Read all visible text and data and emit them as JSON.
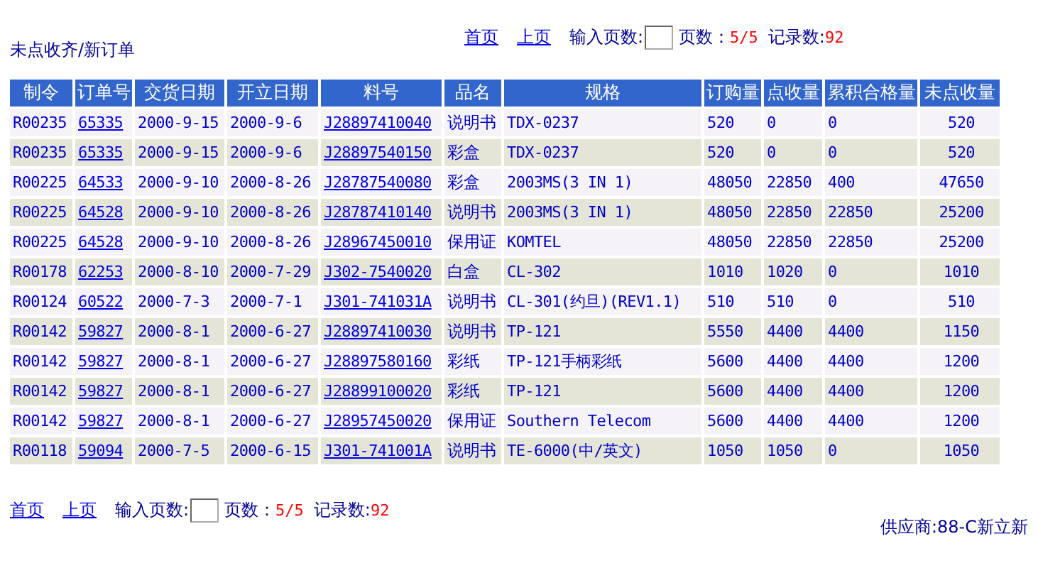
{
  "title": "未点收齐/新订单",
  "pager_top": {
    "links": [
      "首页",
      "上页"
    ],
    "input_label": "输入页数:",
    "page_label": "页数：",
    "page_value": "5/5",
    "record_label": "记录数:",
    "record_value": "92"
  },
  "table": {
    "columns": [
      {
        "label": "制令",
        "kind": "text"
      },
      {
        "label": "订单号",
        "kind": "link"
      },
      {
        "label": "交货日期",
        "kind": "text"
      },
      {
        "label": "开立日期",
        "kind": "text"
      },
      {
        "label": "料号",
        "kind": "link"
      },
      {
        "label": "品名",
        "kind": "text"
      },
      {
        "label": "规格",
        "kind": "text"
      },
      {
        "label": "订购量",
        "kind": "text"
      },
      {
        "label": "点收量",
        "kind": "text"
      },
      {
        "label": "累积合格量",
        "kind": "text"
      },
      {
        "label": "未点收量",
        "kind": "centered"
      }
    ],
    "rows": [
      [
        "R00235",
        "65335",
        "2000-9-15",
        "2000-9-6",
        "J28897410040",
        "说明书",
        "TDX-0237",
        "520",
        "0",
        "0",
        "520"
      ],
      [
        "R00235",
        "65335",
        "2000-9-15",
        "2000-9-6",
        "J28897540150",
        "彩盒",
        "TDX-0237",
        "520",
        "0",
        "0",
        "520"
      ],
      [
        "R00225",
        "64533",
        "2000-9-10",
        "2000-8-26",
        "J28787540080",
        "彩盒",
        "2003MS(3 IN 1)",
        "48050",
        "22850",
        "400",
        "47650"
      ],
      [
        "R00225",
        "64528",
        "2000-9-10",
        "2000-8-26",
        "J28787410140",
        "说明书",
        "2003MS(3 IN 1)",
        "48050",
        "22850",
        "22850",
        "25200"
      ],
      [
        "R00225",
        "64528",
        "2000-9-10",
        "2000-8-26",
        "J28967450010",
        "保用证",
        "KOMTEL",
        "48050",
        "22850",
        "22850",
        "25200"
      ],
      [
        "R00178",
        "62253",
        "2000-8-10",
        "2000-7-29",
        "J302-7540020",
        "白盒",
        "CL-302",
        "1010",
        "1020",
        "0",
        "1010"
      ],
      [
        "R00124",
        "60522",
        "2000-7-3",
        "2000-7-1",
        "J301-741031A",
        "说明书",
        "CL-301(约旦)(REV1.1)",
        "510",
        "510",
        "0",
        "510"
      ],
      [
        "R00142",
        "59827",
        "2000-8-1",
        "2000-6-27",
        "J28897410030",
        "说明书",
        "TP-121",
        "5550",
        "4400",
        "4400",
        "1150"
      ],
      [
        "R00142",
        "59827",
        "2000-8-1",
        "2000-6-27",
        "J28897580160",
        "彩纸",
        "TP-121手柄彩纸",
        "5600",
        "4400",
        "4400",
        "1200"
      ],
      [
        "R00142",
        "59827",
        "2000-8-1",
        "2000-6-27",
        "J28899100020",
        "彩纸",
        "TP-121",
        "5600",
        "4400",
        "4400",
        "1200"
      ],
      [
        "R00142",
        "59827",
        "2000-8-1",
        "2000-6-27",
        "J28957450020",
        "保用证",
        "Southern Telecom",
        "5600",
        "4400",
        "4400",
        "1200"
      ],
      [
        "R00118",
        "59094",
        "2000-7-5",
        "2000-6-15",
        "J301-741001A",
        "说明书",
        "TE-6000(中/英文)",
        "1050",
        "1050",
        "0",
        "1050"
      ]
    ]
  },
  "pager_bottom": {
    "links": [
      "首页",
      "上页"
    ],
    "input_label": "输入页数:",
    "page_label": "页数：",
    "page_value": "5/5",
    "record_label": "记录数:",
    "record_value": "92"
  },
  "supplier": "供应商:88-C新立新"
}
